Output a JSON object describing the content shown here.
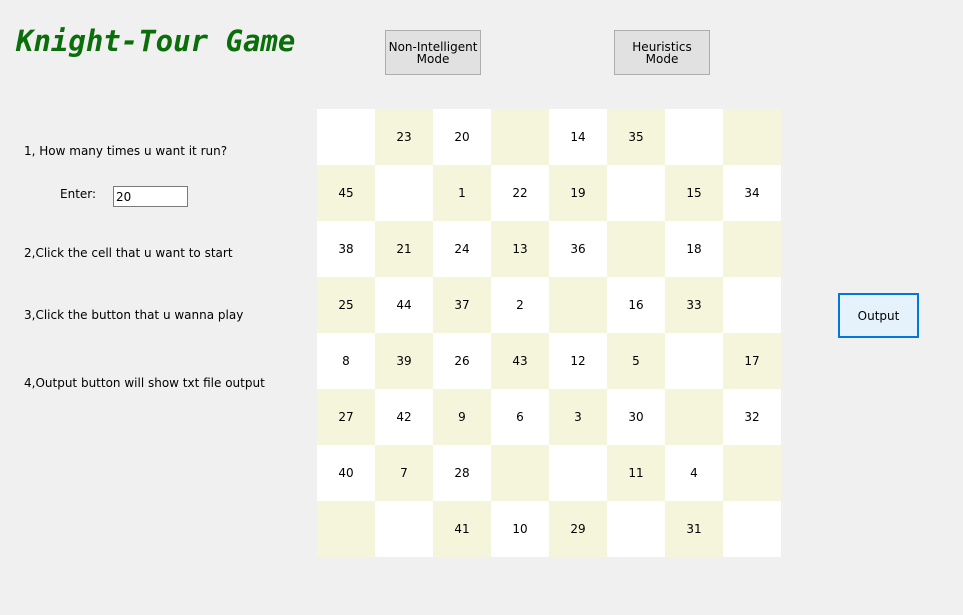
{
  "app": {
    "title": "Knight-Tour Game"
  },
  "modes": {
    "non_intelligent_label": "Non-Intelligent\nMode",
    "heuristics_label": "Heuristics\nMode"
  },
  "instructions": {
    "step1": "1, How many times u want it run?",
    "enter_label": "Enter:",
    "step2": "2,Click the cell that u want to start",
    "step3": "3,Click the button that u wanna play",
    "step4": "4,Output button will show txt file output"
  },
  "run_count": {
    "value": "20"
  },
  "output_button": {
    "label": "Output"
  },
  "colors": {
    "title": "#0a6e0a",
    "board_light": "#ffffff",
    "board_dark": "#f5f5dc",
    "background": "#f0f0f0",
    "output_border": "#0078d7"
  },
  "board": {
    "rows": [
      [
        "",
        "23",
        "20",
        "",
        "14",
        "35",
        "",
        ""
      ],
      [
        "45",
        "",
        "1",
        "22",
        "19",
        "",
        "15",
        "34"
      ],
      [
        "38",
        "21",
        "24",
        "13",
        "36",
        "",
        "18",
        ""
      ],
      [
        "25",
        "44",
        "37",
        "2",
        "",
        "16",
        "33",
        ""
      ],
      [
        "8",
        "39",
        "26",
        "43",
        "12",
        "5",
        "",
        "17"
      ],
      [
        "27",
        "42",
        "9",
        "6",
        "3",
        "30",
        "",
        "32"
      ],
      [
        "40",
        "7",
        "28",
        "",
        "",
        "11",
        "4",
        ""
      ],
      [
        "",
        "",
        "41",
        "10",
        "29",
        "",
        "31",
        ""
      ]
    ]
  }
}
